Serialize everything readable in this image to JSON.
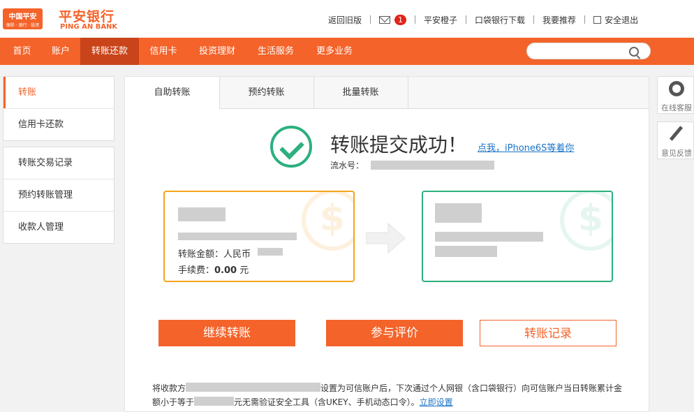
{
  "header": {
    "logo_line1": "中国平安",
    "logo_line2": "保险 · 银行 · 投资",
    "brand_cn": "平安银行",
    "brand_en": "PING AN BANK",
    "links": {
      "old_version": "返回旧版",
      "mail_count": "1",
      "pingan_orange": "平安橙子",
      "pocket_bank": "口袋银行下载",
      "recommend": "我要推荐",
      "logout": "安全退出"
    }
  },
  "nav": {
    "items": [
      "首页",
      "账户",
      "转账还款",
      "信用卡",
      "投资理财",
      "生活服务",
      "更多业务"
    ],
    "active": "转账还款",
    "search_placeholder": ""
  },
  "sidebar": {
    "group1": [
      "转账",
      "信用卡还款"
    ],
    "group2": [
      "转账交易记录",
      "预约转账管理",
      "收款人管理"
    ],
    "active": "转账"
  },
  "tabs": [
    "自助转账",
    "预约转账",
    "批量转账"
  ],
  "result": {
    "title": "转账提交成功！",
    "promo_link": "点我，iPhone6S等着你",
    "serial_label": "流水号："
  },
  "from_card": {
    "amount_label": "转账金额：人民币",
    "fee_label": "手续费：",
    "fee_value": "0.00",
    "fee_unit": "元"
  },
  "coin_symbol": "$",
  "buttons": {
    "continue": "继续转账",
    "evaluate": "参与评价",
    "records": "转账记录"
  },
  "notice": {
    "part1": "将收款方",
    "part2": "设置为可信账户后，下次通过个人网银（含口袋银行）向可信账户当日转账累计金额小于等于",
    "part3": "元无需验证安全工具（含UKEY、手机动态口令）。",
    "link": "立即设置"
  },
  "right_widgets": {
    "service": "在线客服",
    "feedback": "意见反馈"
  }
}
